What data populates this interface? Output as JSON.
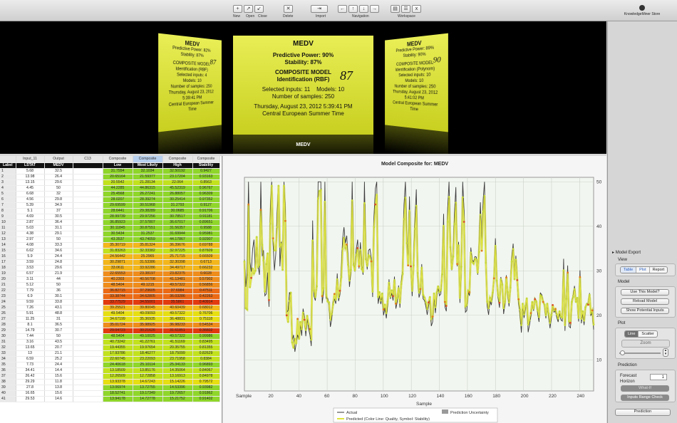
{
  "toolbar": {
    "file_buttons": [
      {
        "icon": "new-doc-icon",
        "label": "New",
        "glyph": "+"
      },
      {
        "icon": "open-icon",
        "label": "Open",
        "glyph": "↗"
      },
      {
        "icon": "close-icon",
        "label": "Close",
        "glyph": "↙"
      }
    ],
    "delete_label": "Delete",
    "import_label": "Import",
    "navigation_label": "Navigation",
    "workspace_label": "Workspace",
    "store_label": "KnowledgeMiner Store"
  },
  "cards": {
    "main": {
      "title": "MEDV",
      "predictive_power": "Predictive Power: 90%",
      "stability": "Stability: 87%",
      "score": "87",
      "model": "COMPOSITE MODEL",
      "model_sub": "Identification (RBF)",
      "inputs": "Selected inputs: 11",
      "models": "Models: 10",
      "samples": "Number of samples: 250",
      "date": "Thursday, August 23, 2012 5:39:41 PM",
      "tz": "Central European Summer Time"
    },
    "left": {
      "title": "MEDV",
      "predictive_power": "Predictive Power: 82%",
      "stability": "Stability: 87%",
      "score": "87",
      "model": "COMPOSITE MODEL",
      "model_sub": "Identification (RBF)",
      "inputs": "Selected inputs: 4",
      "models": "Models: 10",
      "samples": "Number of samples: 250",
      "date": "Thursday, August 23, 2012 5:39:41 PM",
      "tz": "Central European Summer Time"
    },
    "right": {
      "title": "MEDV",
      "predictive_power": "Predictive Power: 89%",
      "stability": "Stability: 90%",
      "score": "90",
      "model": "COMPOSITE MODEL",
      "model_sub": "Identification (Polynom)",
      "inputs": "Selected inputs: 10",
      "models": "Models: 10",
      "samples": "Number of samples: 250",
      "date": "Thursday, August 23, 2012 5:41:02 PM",
      "tz": "Central European Summer Time"
    },
    "caption": "MEDV"
  },
  "grid": {
    "top_headers": [
      "",
      "Input_11",
      "Output",
      "C13",
      "Composite",
      "Composite",
      "Composite",
      "Composite"
    ],
    "sub_headers": [
      "Label",
      "LSTAT",
      "MEDV",
      "",
      "Low",
      "Most Likely",
      "High",
      "Stability"
    ],
    "rows": [
      [
        "1",
        "5.68",
        "32.5",
        "",
        "31.7554",
        "32.1034",
        "32.50192",
        "0.9427"
      ],
      [
        "2",
        "13.98",
        "26.4",
        "",
        "20.65164",
        "21.59377",
        "23.17204",
        "0.93163"
      ],
      [
        "3",
        "13.15",
        "29.6",
        "",
        "20.5542",
        "21.28134",
        "22.064",
        "0.8563"
      ],
      [
        "4",
        "4.45",
        "50",
        "",
        "44.2285",
        "44.86315",
        "45.52319",
        "0.96767"
      ],
      [
        "5",
        "6.68",
        "32",
        "",
        "25.4568",
        "26.27241",
        "26.88057",
        "0.96309"
      ],
      [
        "6",
        "4.56",
        "29.8",
        "",
        "28.0207",
        "28.39274",
        "30.25414",
        "0.97352"
      ],
      [
        "7",
        "5.39",
        "34.9",
        "",
        "29.69599",
        "30.51968",
        "31.2793",
        "0.9127"
      ],
      [
        "8",
        "5.1",
        "37",
        "",
        "28.6441",
        "29.38289",
        "30.0685",
        "0.91706"
      ],
      [
        "9",
        "4.69",
        "30.5",
        "",
        "28.99739",
        "29.97256",
        "30.78517",
        "0.91181"
      ],
      [
        "10",
        "2.87",
        "36.4",
        "",
        "36.85923",
        "37.57807",
        "36.67017",
        "0.89651"
      ],
      [
        "11",
        "5.03",
        "31.1",
        "",
        "30.11845",
        "30.87551",
        "31.56357",
        "0.9588"
      ],
      [
        "12",
        "4.38",
        "29.1",
        "",
        "30.5434",
        "31.2537",
        "31.69944",
        "0.95981"
      ],
      [
        "13",
        "2.97",
        "50",
        "",
        "43.3537",
        "43.74059",
        "44.17867",
        "0.92907"
      ],
      [
        "14",
        "4.08",
        "33.3",
        "",
        "35.30719",
        "35.81324",
        "36.39676",
        "0.69788"
      ],
      [
        "15",
        "6.62",
        "34.6",
        "",
        "31.83263",
        "32.33382",
        "32.97225",
        "0.87609"
      ],
      [
        "16",
        "5.9",
        "24.4",
        "",
        "24.56442",
        "25.2965",
        "25.71715",
        "0.66509"
      ],
      [
        "17",
        "3.59",
        "24.8",
        "",
        "30.29871",
        "31.53386",
        "32.30398",
        "0.6713"
      ],
      [
        "18",
        "3.53",
        "29.6",
        "",
        "33.0611",
        "33.92286",
        "34.49717",
        "0.66232"
      ],
      [
        "19",
        "6.57",
        "21.9",
        "",
        "22.65553",
        "23.38197",
        "23.82375",
        "0.6028"
      ],
      [
        "20",
        "3.11",
        "44",
        "",
        "40.2303",
        "40.56708",
        "41.13481",
        "0.57902"
      ],
      [
        "21",
        "5.12",
        "50",
        "",
        "48.5404",
        "49.1215",
        "49.57322",
        "0.56856"
      ],
      [
        "22",
        "7.79",
        "36",
        "",
        "36.82715",
        "37.29605",
        "37.6984",
        "0.47511"
      ],
      [
        "23",
        "6.9",
        "30.1",
        "",
        "33.38744",
        "34.62805",
        "36.03286",
        "0.42263"
      ],
      [
        "24",
        "9.59",
        "33.8",
        "",
        "33.77529",
        "34.55001",
        "35.5861",
        "0.40914"
      ],
      [
        "25",
        "7.26",
        "43.1",
        "",
        "39.25521",
        "39.80045",
        "40.60439",
        "0.68012"
      ],
      [
        "26",
        "5.91",
        "48.8",
        "",
        "49.5404",
        "49.09093",
        "49.57322",
        "0.76706"
      ],
      [
        "27",
        "11.25",
        "31",
        "",
        "34.67199",
        "35.36935",
        "36.48831",
        "0.75118"
      ],
      [
        "28",
        "8.1",
        "36.5",
        "",
        "35.01724",
        "35.98925",
        "36.98233",
        "0.54534"
      ],
      [
        "29",
        "14.79",
        "30.7",
        "",
        "29.04723",
        "30.21626",
        "31.61851",
        "0.36602"
      ],
      [
        "30",
        "7.44",
        "50",
        "",
        "48.5404",
        "49.10025",
        "49.57322",
        "0.99986"
      ],
      [
        "31",
        "3.16",
        "43.5",
        "",
        "40.73242",
        "41.22761",
        "41.51169",
        "0.83495"
      ],
      [
        "32",
        "13.65",
        "20.7",
        "",
        "19.44355",
        "19.97654",
        "20.35755",
        "0.81355"
      ],
      [
        "33",
        "13",
        "21.1",
        "",
        "17.93786",
        "18.46277",
        "18.75099",
        "0.82629"
      ],
      [
        "34",
        "6.59",
        "25.2",
        "",
        "22.60745",
        "23.22093",
        "23.71958",
        "0.8384"
      ],
      [
        "35",
        "7.73",
        "24.4",
        "",
        "24.40618",
        "25.10114",
        "25.34133",
        "0.96893"
      ],
      [
        "36",
        "34.41",
        "14.4",
        "",
        "13.18509",
        "13.85176",
        "14.35064",
        "0.84067"
      ],
      [
        "37",
        "26.42",
        "15.6",
        "",
        "12.26509",
        "12.72858",
        "13.16913",
        "0.84978"
      ],
      [
        "38",
        "29.29",
        "11.8",
        "",
        "13.93378",
        "14.67243",
        "15.14226",
        "0.79572"
      ],
      [
        "39",
        "27.8",
        "13.8",
        "",
        "13.06974",
        "13.72755",
        "14.53396",
        "0.93982"
      ],
      [
        "40",
        "16.65",
        "15.6",
        "",
        "18.52741",
        "19.17349",
        "19.72657",
        "0.91862"
      ],
      [
        "41",
        "29.53",
        "14.6",
        "",
        "13.94178",
        "14.72778",
        "15.21752",
        "0.91402"
      ]
    ]
  },
  "chart_data": {
    "type": "line",
    "title": "Model Composite for: MEDV",
    "xlabel": "Sample",
    "xlim": [
      1,
      250
    ],
    "ylim": [
      3,
      51
    ],
    "yticks": [
      10,
      20,
      30,
      40,
      50
    ],
    "xticks": [
      20,
      40,
      60,
      80,
      100,
      120,
      140,
      160,
      180,
      200,
      220,
      240
    ],
    "grid": true,
    "legend_position": "bottom",
    "legend": {
      "actual": "Actual",
      "uncertainty": "Prediction Uncertainty",
      "predicted": "Predicted (Color Line: Quality, Symbol: Stability)"
    },
    "series": [
      {
        "name": "Actual",
        "values": [
          32.5,
          26.4,
          29.6,
          50,
          32,
          29.8,
          34.9,
          37,
          30.5,
          36.4,
          31.1,
          29.1,
          50,
          33.3,
          34.6,
          24.4,
          24.8,
          29.6,
          21.9,
          44,
          50,
          36,
          30.1,
          33.8,
          43.1,
          48.8,
          31,
          36.5,
          30.7,
          50,
          43.5,
          20.7,
          21.1,
          25.2,
          24.4,
          14.4,
          15.6,
          11.8,
          13.8,
          15.6,
          14.6,
          17.8,
          15.4,
          21.5,
          19.6,
          15.3,
          19.4,
          17,
          15.6,
          13.1,
          41.3,
          24.3,
          23.3,
          27,
          50,
          50,
          50,
          22.7,
          25,
          50,
          23.8,
          23.8,
          22.3,
          17.4,
          19.1,
          23.1,
          23.6,
          22.6,
          29.4,
          23.2,
          24.6,
          29.9,
          37.2,
          39.8,
          36.2,
          37.9,
          32.5,
          26.4,
          29.6,
          50,
          32,
          29.8,
          34.9,
          37,
          30.5,
          36.4,
          31.1,
          29.1,
          50,
          33.3,
          30.3,
          34.6,
          34.9,
          32.9,
          24.1,
          42.3,
          48.5,
          50,
          22.6,
          24.4,
          22.5,
          24.4,
          20,
          21.7,
          19.3,
          22.4,
          28.1,
          23.7,
          25,
          23.3,
          28.7,
          21.5,
          23,
          26.7,
          21.7,
          27.5,
          30.1,
          44.8,
          50,
          37.6,
          31.6,
          46.7,
          31.5,
          24.3,
          31.7,
          41.7,
          48.3,
          29,
          24,
          25.1,
          31.5,
          23.7,
          23.3,
          22,
          20.1,
          22.2,
          23.7,
          17.6,
          18.5,
          24.3,
          20.5,
          24.5,
          26.2,
          24.4,
          24.8,
          29.6,
          42.8,
          21.9,
          20.9,
          44,
          50,
          36,
          30.1,
          33.8,
          43.1,
          48.8,
          31,
          36.5,
          22.8,
          30.7,
          50,
          43.5,
          20.7,
          21.1,
          25.2,
          24.4,
          35.2,
          32.4,
          32,
          33.2,
          33.1,
          29.1,
          35.1,
          45.4,
          35.4,
          46,
          50,
          32.2,
          22,
          20.1,
          23.2,
          22.3,
          24.8,
          28.5,
          37.3,
          27.9,
          23.9,
          21.7,
          28.6,
          27.1,
          20.3,
          22.5,
          29,
          24.8,
          22,
          26.4,
          33.1,
          36.1,
          28.4,
          33.4,
          28.2,
          22.8,
          20.3,
          16.1,
          22.1,
          19.4,
          21.6,
          23.8,
          16.2,
          17.8,
          19.8,
          23.1,
          21,
          23.8,
          23.1,
          20.4,
          18.5,
          25,
          24.6,
          23,
          22.2,
          19.3,
          22.6,
          19.8,
          17.1,
          19.4,
          22.2,
          20.7,
          21.1,
          19.5,
          18.5,
          20.6,
          19,
          18.7,
          32.7,
          16.5,
          23.9,
          31.2,
          17.5,
          17.2,
          23.1,
          24.5,
          26.6,
          22.9,
          24.1,
          18.6,
          30.1,
          18.2,
          20.6,
          17.8,
          21.7,
          22.7,
          22.6,
          25,
          19.9,
          20.8,
          16.8
        ]
      },
      {
        "name": "Predicted",
        "values": [
          32.1,
          21.6,
          21.3,
          44.9,
          26.3,
          28.4,
          30.5,
          29.4,
          30.0,
          37.6,
          30.9,
          31.3,
          43.7,
          35.8,
          32.3,
          25.3,
          31.5,
          33.9,
          23.4,
          40.6,
          49.1,
          37.3,
          34.6,
          34.6,
          39.8,
          49.1,
          35.4,
          36.0,
          30.2,
          49.1,
          41.2,
          20.0,
          18.5,
          23.2,
          25.1,
          13.9,
          12.7,
          14.7,
          13.7,
          19.2,
          14.7,
          18.5,
          16.9,
          20.6,
          19.0,
          16.7,
          19.9,
          18.1,
          16.9,
          14.5,
          36.8,
          25.6,
          24.1,
          26.5,
          46.2,
          47.9,
          48.1,
          24.3,
          26.1,
          45.5,
          24.6,
          23.1,
          22.9,
          19.0,
          20.3,
          22.4,
          24.8,
          23.5,
          28.1,
          24.0,
          25.5,
          28.6,
          34.9,
          37.4,
          35.1,
          35.9,
          31.4,
          27.8,
          30.2,
          45.8,
          31.3,
          30.1,
          33.6,
          35.1,
          31.0,
          34.7,
          30.4,
          29.8,
          45.2,
          32.6,
          31.1,
          33.5,
          33.2,
          32.1,
          25.3,
          39.8,
          44.9,
          47.1,
          24.1,
          25.2,
          23.3,
          24.9,
          21.3,
          22.4,
          20.5,
          23.1,
          27.3,
          24.2,
          25.6,
          24.3,
          27.9,
          22.6,
          23.9,
          26.1,
          22.8,
          27.0,
          29.3,
          41.6,
          46.4,
          36.2,
          31.2,
          43.5,
          31.0,
          25.5,
          31.2,
          39.4,
          44.6,
          29.5,
          25.1,
          25.9,
          30.7,
          24.6,
          24.0,
          22.9,
          21.4,
          22.9,
          24.1,
          19.2,
          19.7,
          24.9,
          21.8,
          25.1,
          26.5,
          25.3,
          25.6,
          29.2,
          40.1,
          23.0,
          22.1,
          41.0,
          46.6,
          35.3,
          30.4,
          33.2,
          40.5,
          45.3,
          31.5,
          35.7,
          23.9,
          30.9,
          46.5,
          41.0,
          22.0,
          22.3,
          25.5,
          25.2,
          34.1,
          32.0,
          31.6,
          32.7,
          32.5,
          29.6,
          34.2,
          42.6,
          34.5,
          43.3,
          46.8,
          31.8,
          23.1,
          21.6,
          23.9,
          23.2,
          25.1,
          28.3,
          35.6,
          27.8,
          24.5,
          22.8,
          28.1,
          26.9,
          21.6,
          23.1,
          28.5,
          25.2,
          22.9,
          26.2,
          32.1,
          34.9,
          28.1,
          32.5,
          27.9,
          23.6,
          21.3,
          17.8,
          22.6,
          20.2,
          22.1,
          23.8,
          17.9,
          18.9,
          20.5,
          23.0,
          21.5,
          23.6,
          23.1,
          21.1,
          19.6,
          24.5,
          24.2,
          23.0,
          22.4,
          20.0,
          22.6,
          20.4,
          18.3,
          20.1,
          22.3,
          21.1,
          21.4,
          20.2,
          19.3,
          20.9,
          19.7,
          19.5,
          30.1,
          17.8,
          23.7,
          29.6,
          18.6,
          18.3,
          23.0,
          24.1,
          25.9,
          23.0,
          23.9,
          19.4,
          28.6,
          19.2,
          20.9,
          18.8,
          21.8,
          22.5,
          22.4,
          24.6,
          20.5,
          21.1,
          17.9
        ]
      }
    ]
  },
  "panel": {
    "model_export": "Model Export",
    "view": "View",
    "view_options": [
      "Table",
      "Plot",
      "Report"
    ],
    "model": "Model",
    "use_model": "Use This Model?",
    "reload_model": "Reload Model",
    "show_inputs": "Show Potential Inputs",
    "plot": "Plot",
    "plot_options": [
      "Line",
      "Scatter"
    ],
    "zoom": "Zoom",
    "prediction": "Prediction",
    "forecast_horizon": "Forecast Horizon",
    "forecast_value": "1",
    "what_if": "What-If",
    "inputs_range": "Inputs Range Check",
    "prediction_tab": "Prediction"
  }
}
